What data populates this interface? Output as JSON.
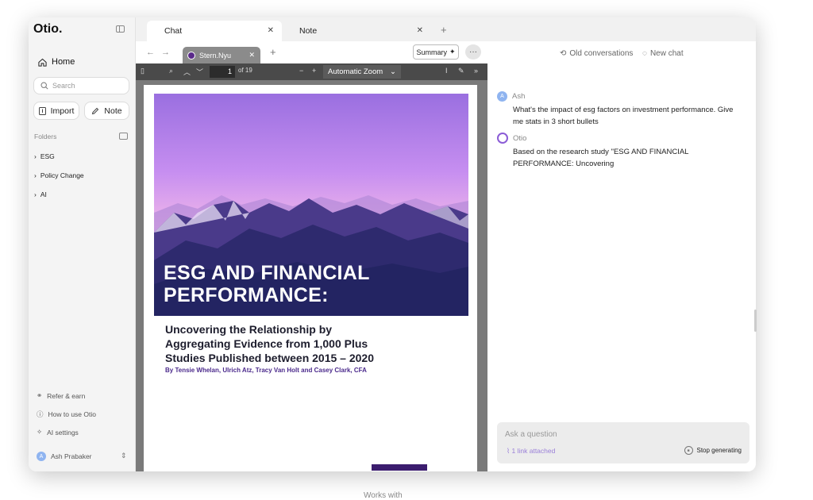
{
  "sidebar": {
    "logo": "Otio.",
    "home": "Home",
    "search_placeholder": "Search",
    "import": "Import",
    "note": "Note",
    "folders_label": "Folders",
    "folders": [
      "ESG",
      "Policy Change",
      "AI"
    ],
    "bottom": {
      "refer": "Refer & earn",
      "how_to": "How to use Otio",
      "ai_settings": "AI settings",
      "user_initial": "A",
      "user_name": "Ash Prabaker"
    }
  },
  "tabs": [
    {
      "label": "Chat"
    },
    {
      "label": "Note"
    }
  ],
  "doc": {
    "tab_label": "Stern.Nyu",
    "summary": "Summary",
    "more": "···",
    "page_current": "1",
    "page_total": "of 19",
    "zoom": "Automatic Zoom",
    "title_line1": "ESG AND FINANCIAL",
    "title_line2": "PERFORMANCE:",
    "subtitle_line1": "Uncovering the Relationship by",
    "subtitle_line2": "Aggregating Evidence from 1,000 Plus",
    "subtitle_line3": "Studies Published between 2015 – 2020",
    "authors": "By Tensie Whelan, Ulrich Atz, Tracy Van Holt and Casey Clark, CFA"
  },
  "chat": {
    "old_conversations": "Old conversations",
    "new_chat": "New chat",
    "messages": [
      {
        "author": "Ash",
        "initial": "A",
        "text": "What's the impact of esg factors on investment performance. Give me stats in 3 short bullets"
      },
      {
        "author": "Otio",
        "text": "Based on the research study \"ESG AND FINANCIAL PERFORMANCE: Uncovering"
      }
    ],
    "ask_placeholder": "Ask a question",
    "link_attached": "1 link attached",
    "stop_generating": "Stop generating"
  },
  "caption": "Works with"
}
